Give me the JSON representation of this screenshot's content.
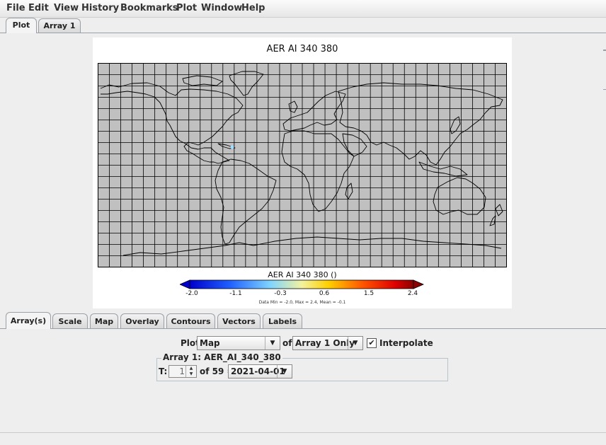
{
  "menu": [
    "File",
    "Edit",
    "View",
    "History",
    "Bookmarks",
    "Plot",
    "Window",
    "Help"
  ],
  "top_tabs": [
    "Plot",
    "Array 1"
  ],
  "plot": {
    "title": "AER AI 340 380",
    "colorbar_title": "AER AI 340 380 ()",
    "colorbar_ticks": [
      "-2.0",
      "-1.1",
      "-0.3",
      "0.6",
      "1.5",
      "2.4"
    ],
    "stats": "Data Min = -2.0, Max = 2.4, Mean = -0.1"
  },
  "bottom_tabs": [
    "Array(s)",
    "Scale",
    "Map",
    "Overlay",
    "Contours",
    "Vectors",
    "Labels"
  ],
  "controls": {
    "plot_label": "Plot",
    "plot_type": "Map",
    "of_label": "of",
    "array_choice": "Array 1 Only",
    "interpolate_label": "Interpolate",
    "interpolate_checked": "✔",
    "array_group_title": "Array 1: AER_AI_340_380",
    "t_label": "T:",
    "t_value": "1",
    "of_count": "of 59 =",
    "date_value": "2021-04-01"
  },
  "icons": {
    "combo_arrow": "chevron-down-icon",
    "spinner_up": "arrow-up-icon",
    "spinner_down": "arrow-down-icon",
    "checkbox": "check-icon"
  },
  "colors": {
    "map_fill": "#c0c0c0",
    "coastline": "#000000",
    "colorbar_low": "#0000cc",
    "colorbar_high": "#8b0000"
  }
}
